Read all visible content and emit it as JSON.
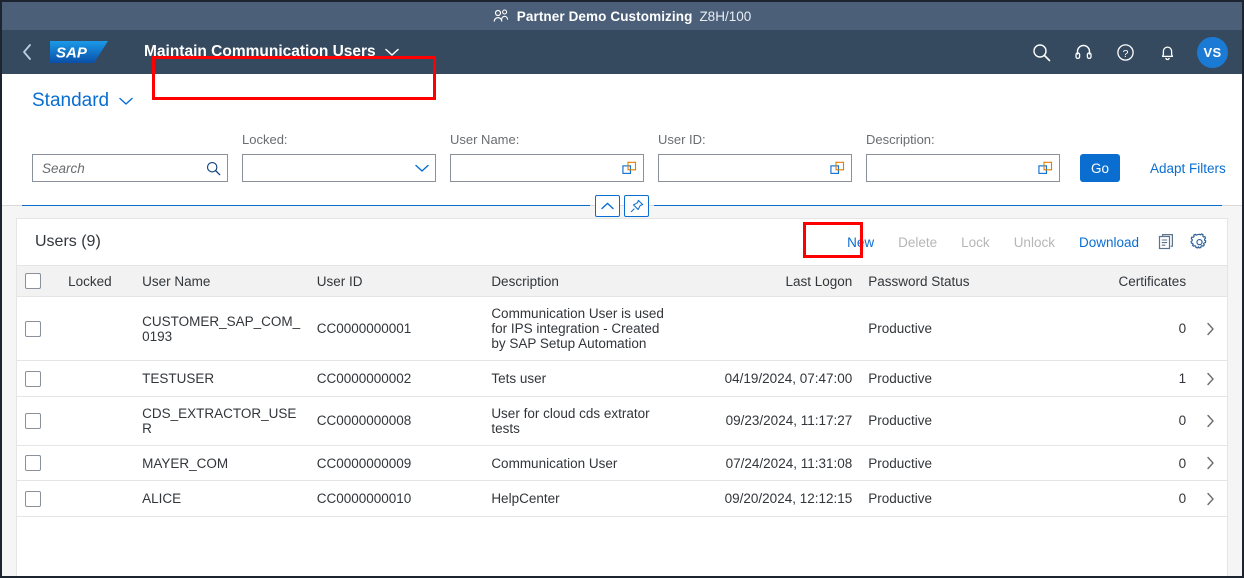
{
  "context_bar": {
    "icon": "group-users-icon",
    "title": "Partner Demo Customizing",
    "client": "Z8H/100"
  },
  "shell": {
    "back_icon": "chevron-left-icon",
    "logo_text": "SAP",
    "app_title": "Maintain Communication Users",
    "title_chevron_icon": "chevron-down-icon",
    "actions": [
      {
        "name": "search-icon",
        "label": "Search"
      },
      {
        "name": "headset-icon",
        "label": "Support"
      },
      {
        "name": "question-mark-icon",
        "label": "Help"
      },
      {
        "name": "bell-icon",
        "label": "Notifications"
      }
    ],
    "avatar_initials": "VS",
    "highlight_color": "#ff0000"
  },
  "variant": {
    "name": "Standard",
    "chevron_icon": "chevron-down-icon"
  },
  "filters": {
    "search": {
      "placeholder": "Search",
      "value": "",
      "icon": "search-icon"
    },
    "fields": [
      {
        "label": "Locked:",
        "value": "",
        "type": "select",
        "icon": "chevron-down-icon"
      },
      {
        "label": "User Name:",
        "value": "",
        "type": "valuehelp",
        "icon": "value-help-icon"
      },
      {
        "label": "User ID:",
        "value": "",
        "type": "valuehelp",
        "icon": "value-help-icon"
      },
      {
        "label": "Description:",
        "value": "",
        "type": "valuehelp",
        "icon": "value-help-icon"
      }
    ],
    "go_label": "Go",
    "adapt_filters_label": "Adapt Filters",
    "collapse_icon": "chevron-up-icon",
    "pin_icon": "pin-icon"
  },
  "table": {
    "title": "Users (9)",
    "actions": [
      {
        "label": "New",
        "enabled": true,
        "highlighted": true
      },
      {
        "label": "Delete",
        "enabled": false,
        "highlighted": false
      },
      {
        "label": "Lock",
        "enabled": false,
        "highlighted": false
      },
      {
        "label": "Unlock",
        "enabled": false,
        "highlighted": false
      },
      {
        "label": "Download",
        "enabled": true,
        "highlighted": false
      }
    ],
    "icon_actions": [
      {
        "name": "copy-icon"
      },
      {
        "name": "gear-icon"
      }
    ],
    "columns": [
      "Locked",
      "User Name",
      "User ID",
      "Description",
      "Last Logon",
      "Password Status",
      "Certificates"
    ],
    "rows": [
      {
        "locked": "",
        "user_name": "CUSTOMER_SAP_COM_0193",
        "user_id": "CC0000000001",
        "description": "Communication User is used for IPS integration - Created by SAP Setup Automation",
        "last_logon": "",
        "password_status": "Productive",
        "certificates": "0"
      },
      {
        "locked": "",
        "user_name": "TESTUSER",
        "user_id": "CC0000000002",
        "description": "Tets user",
        "last_logon": "04/19/2024, 07:47:00",
        "password_status": "Productive",
        "certificates": "1"
      },
      {
        "locked": "",
        "user_name": "CDS_EXTRACTOR_USER",
        "user_id": "CC0000000008",
        "description": "User for cloud cds extrator tests",
        "last_logon": "09/23/2024, 11:17:27",
        "password_status": "Productive",
        "certificates": "0"
      },
      {
        "locked": "",
        "user_name": "MAYER_COM",
        "user_id": "CC0000000009",
        "description": "Communication User",
        "last_logon": "07/24/2024, 11:31:08",
        "password_status": "Productive",
        "certificates": "0"
      },
      {
        "locked": "",
        "user_name": "ALICE",
        "user_id": "CC0000000010",
        "description": "HelpCenter",
        "last_logon": "09/20/2024, 12:12:15",
        "password_status": "Productive",
        "certificates": "0"
      }
    ],
    "row_nav_icon": "chevron-right-icon"
  },
  "colors": {
    "shell_bg": "#354a5f",
    "context_bg": "#4b5f79",
    "accent": "#0a6ed1",
    "highlight": "#ff0000"
  }
}
